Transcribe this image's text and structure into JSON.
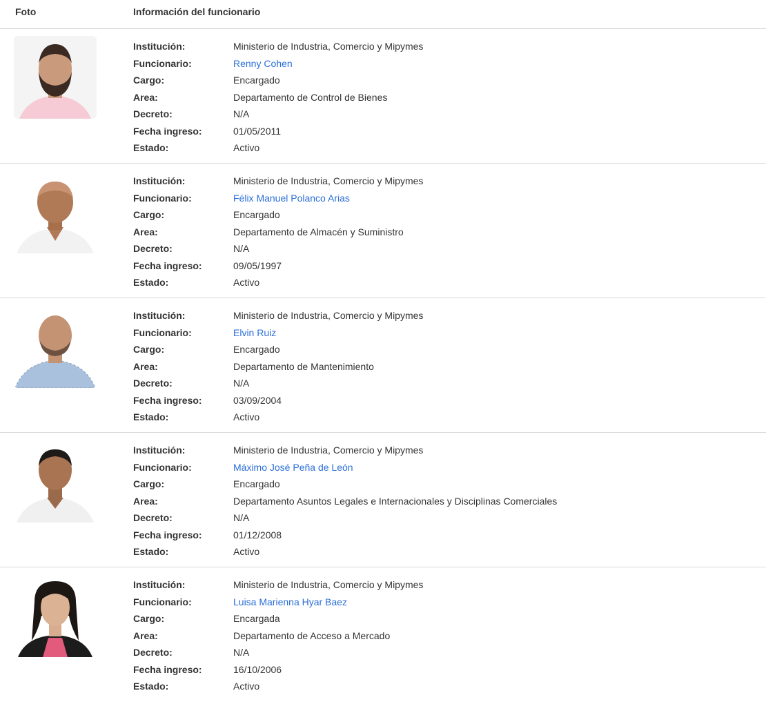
{
  "header": {
    "photo_label": "Foto",
    "info_label": "Información del funcionario"
  },
  "field_labels": {
    "institucion": "Institución:",
    "funcionario": "Funcionario:",
    "cargo": "Cargo:",
    "area": "Area:",
    "decreto": "Decreto:",
    "fecha_ingreso": "Fecha ingreso:",
    "estado": "Estado:"
  },
  "colors": {
    "link": "#2a6ed8",
    "divider": "#d9d9d9"
  },
  "employees": [
    {
      "institucion": "Ministerio de Industria, Comercio y Mipymes",
      "funcionario": "Renny Cohen",
      "cargo": "Encargado",
      "area": "Departamento de Control de Bienes",
      "decreto": "N/A",
      "fecha_ingreso": "01/05/2011",
      "estado": "Activo"
    },
    {
      "institucion": "Ministerio de Industria, Comercio y Mipymes",
      "funcionario": "Félix Manuel Polanco Arias",
      "cargo": "Encargado",
      "area": "Departamento de Almacén y Suministro",
      "decreto": "N/A",
      "fecha_ingreso": "09/05/1997",
      "estado": "Activo"
    },
    {
      "institucion": "Ministerio de Industria, Comercio y Mipymes",
      "funcionario": "Elvin Ruiz",
      "cargo": "Encargado",
      "area": "Departamento de Mantenimiento",
      "decreto": "N/A",
      "fecha_ingreso": "03/09/2004",
      "estado": "Activo"
    },
    {
      "institucion": "Ministerio de Industria, Comercio y Mipymes",
      "funcionario": "Máximo José Peña de León",
      "cargo": "Encargado",
      "area": "Departamento Asuntos Legales e Internacionales y Disciplinas Comerciales",
      "decreto": "N/A",
      "fecha_ingreso": "01/12/2008",
      "estado": "Activo"
    },
    {
      "institucion": "Ministerio de Industria, Comercio y Mipymes",
      "funcionario": "Luisa Marienna Hyar Baez",
      "cargo": "Encargada",
      "area": "Departamento de Acceso a Mercado",
      "decreto": "N/A",
      "fecha_ingreso": "16/10/2006",
      "estado": "Activo"
    }
  ]
}
